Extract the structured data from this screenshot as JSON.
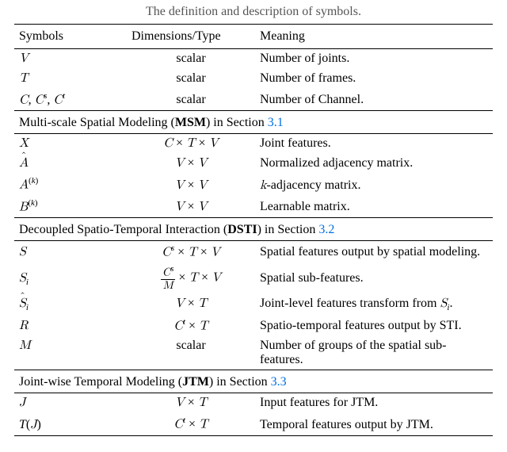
{
  "caption": "The definition and description of symbols.",
  "headers": {
    "c0": "Symbols",
    "c1": "Dimensions/Type",
    "c2": "Meaning"
  },
  "grp1": {
    "r1": {
      "dim": "scalar",
      "mean": "Number of joints."
    },
    "r2": {
      "dim": "scalar",
      "mean": "Number of frames."
    },
    "r3": {
      "dim": "scalar",
      "mean": "Number of Channel."
    }
  },
  "sec2": {
    "pre": "Multi-scale Spatial Modeling (",
    "abbr": "MSM",
    "mid": ") in Section ",
    "ref": "3.1"
  },
  "grp2": {
    "r1": {
      "mean": "Joint features."
    },
    "r2": {
      "mean": "Normalized adjacency matrix."
    },
    "r3": {
      "mean": "-adjacency matrix.",
      "k": "k"
    },
    "r4": {
      "mean": "Learnable matrix."
    }
  },
  "sec3": {
    "pre": "Decoupled Spatio-Temporal Interaction (",
    "abbr": "DSTI",
    "mid": ") in Section ",
    "ref": "3.2"
  },
  "grp3": {
    "r1": {
      "mean": "Spatial features output by spatial modeling."
    },
    "r2": {
      "mean": "Spatial sub-features."
    },
    "r3": {
      "mean_pre": "Joint-level features transform from ",
      "mean_post": "."
    },
    "r4": {
      "mean": "Spatio-temporal features output by STI."
    },
    "r5": {
      "dim": "scalar",
      "mean": "Number of groups of the spatial sub-features."
    }
  },
  "sec4": {
    "pre": "Joint-wise Temporal Modeling (",
    "abbr": "JTM",
    "mid": ") in Section ",
    "ref": "3.3"
  },
  "grp4": {
    "r1": {
      "mean": "Input features for JTM."
    },
    "r2": {
      "mean": "Temporal features output by JTM."
    }
  }
}
